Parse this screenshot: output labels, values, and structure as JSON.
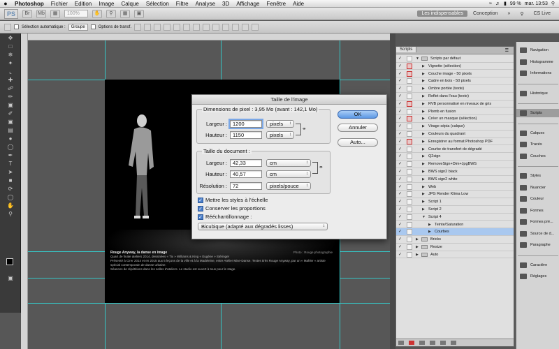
{
  "menubar": {
    "app": "Photoshop",
    "items": [
      "Fichier",
      "Edition",
      "Image",
      "Calque",
      "Sélection",
      "Filtre",
      "Analyse",
      "3D",
      "Affichage",
      "Fenêtre",
      "Aide"
    ],
    "battery": "99 %",
    "clock": "mar. 13:53"
  },
  "appbar": {
    "logo": "PS",
    "zoom": "100%",
    "workspaces": [
      "Les indispensables",
      "Conception"
    ],
    "active_workspace": "Les indispensables",
    "cslive": "CS Live"
  },
  "options": {
    "auto_select": "Sélection automatique :",
    "auto_select_value": "Groupe",
    "transform": "Options de transf."
  },
  "canvas": {
    "caption_title": "Rouge Anyway, la danse en image",
    "caption_credit": "Photo : Rouge photographie",
    "caption_line1": "Quart de finale ateliers 2014, dessinées « Tix » Williams & King « Eugène » Stéringer",
    "caption_line2": "Présenté à Cirer 2014 et en 2015 aux 5 leçons de la ville et à la Madeleine, entre Atelier Mise-Danse. Textes tirés Rouge Anyway, par un « Mahler » artiste spécial contemporain de danse urbaine.",
    "caption_line3": "Séances de répétitions dans les salles d'ateliers. Le studio est ouvert à tous pour le stage."
  },
  "dialog": {
    "title": "Taille de l'image",
    "pixel_group": "Dimensions de pixel : 3,95 Mo (avant : 142,1 Mo)",
    "width_label": "Largeur :",
    "width_value": "1200",
    "width_unit": "pixels",
    "height_label": "Hauteur :",
    "height_value": "1150",
    "height_unit": "pixels",
    "doc_group": "Taille du document :",
    "doc_width_label": "Largeur :",
    "doc_width_value": "42,33",
    "doc_width_unit": "cm",
    "doc_height_label": "Hauteur :",
    "doc_height_value": "40,57",
    "doc_height_unit": "cm",
    "res_label": "Résolution :",
    "res_value": "72",
    "res_unit": "pixels/pouce",
    "chk_scale": "Mettre les styles à l'échelle",
    "chk_constrain": "Conserver les proportions",
    "chk_resample": "Rééchantillonnage :",
    "resample_method": "Bicubique (adapté aux dégradés lisses)",
    "ok": "OK",
    "cancel": "Annuler",
    "auto": "Auto..."
  },
  "scripts_panel": {
    "tab": "Scripts",
    "rows": [
      {
        "label": "Scripts par défaut",
        "level": 0,
        "type": "folder",
        "open": true,
        "red": false
      },
      {
        "label": "Vignette (sélection)",
        "level": 1,
        "type": "action",
        "red": true
      },
      {
        "label": "Couche image - 50 pixels",
        "level": 1,
        "type": "action",
        "red": true
      },
      {
        "label": "Cadre en bois - 50 pixels",
        "level": 1,
        "type": "action",
        "red": false
      },
      {
        "label": "Ombre portée (texte)",
        "level": 1,
        "type": "action",
        "red": false
      },
      {
        "label": "Reflet dans l'eau (texte)",
        "level": 1,
        "type": "action",
        "red": false
      },
      {
        "label": "RVB personnalisé en niveaux de gris",
        "level": 1,
        "type": "action",
        "red": true
      },
      {
        "label": "Plomb en fusion",
        "level": 1,
        "type": "action",
        "red": false
      },
      {
        "label": "Créer un masque (sélection)",
        "level": 1,
        "type": "action",
        "red": true
      },
      {
        "label": "Virage sépia (calque)",
        "level": 1,
        "type": "action",
        "red": false
      },
      {
        "label": "Couleurs du quadrant",
        "level": 1,
        "type": "action",
        "red": false
      },
      {
        "label": "Enregistrer au format Photoshop PDF",
        "level": 1,
        "type": "action",
        "red": true
      },
      {
        "label": "Courbe de transfert de dégradé",
        "level": 1,
        "type": "action",
        "red": false
      },
      {
        "label": "Q2sign",
        "level": 1,
        "type": "action",
        "red": false
      },
      {
        "label": "RemoveSign+Dim+JpgBWS",
        "level": 1,
        "type": "action",
        "red": false
      },
      {
        "label": "BWS sign2 black",
        "level": 1,
        "type": "action",
        "red": false
      },
      {
        "label": "BWS sign2 white",
        "level": 1,
        "type": "action",
        "red": false
      },
      {
        "label": "Web",
        "level": 1,
        "type": "action",
        "red": false
      },
      {
        "label": "JPG Render Klima Low",
        "level": 1,
        "type": "action",
        "red": false
      },
      {
        "label": "Script 1",
        "level": 1,
        "type": "action",
        "red": false
      },
      {
        "label": "Script 2",
        "level": 1,
        "type": "action",
        "red": false
      },
      {
        "label": "Script 4",
        "level": 1,
        "type": "action",
        "open": true,
        "red": false
      },
      {
        "label": "Teinte/Saturation",
        "level": 2,
        "type": "action",
        "red": false
      },
      {
        "label": "Courbes",
        "level": 2,
        "type": "action",
        "red": false,
        "selected": true
      },
      {
        "label": "Bricks",
        "level": 0,
        "type": "folder",
        "open": false,
        "red": false
      },
      {
        "label": "Resize",
        "level": 0,
        "type": "folder",
        "open": false,
        "red": false
      },
      {
        "label": "Auto",
        "level": 0,
        "type": "folder",
        "open": false,
        "red": false
      }
    ]
  },
  "dock": [
    {
      "label": "Navigation",
      "group": 1
    },
    {
      "label": "Histogramme",
      "group": 1
    },
    {
      "label": "Informations",
      "group": 1
    },
    {
      "label": "Historique",
      "group": 2
    },
    {
      "label": "Scripts",
      "group": 3,
      "active": true
    },
    {
      "label": "Calques",
      "group": 4
    },
    {
      "label": "Tracés",
      "group": 4
    },
    {
      "label": "Couches",
      "group": 4
    },
    {
      "label": "Styles",
      "group": 5
    },
    {
      "label": "Nuancier",
      "group": 5
    },
    {
      "label": "Couleur",
      "group": 5
    },
    {
      "label": "Formes",
      "group": 5
    },
    {
      "label": "Formes pré...",
      "group": 5
    },
    {
      "label": "Source de d...",
      "group": 5
    },
    {
      "label": "Paragraphe",
      "group": 5
    },
    {
      "label": "Caractère",
      "group": 6
    },
    {
      "label": "Réglages",
      "group": 6
    }
  ]
}
